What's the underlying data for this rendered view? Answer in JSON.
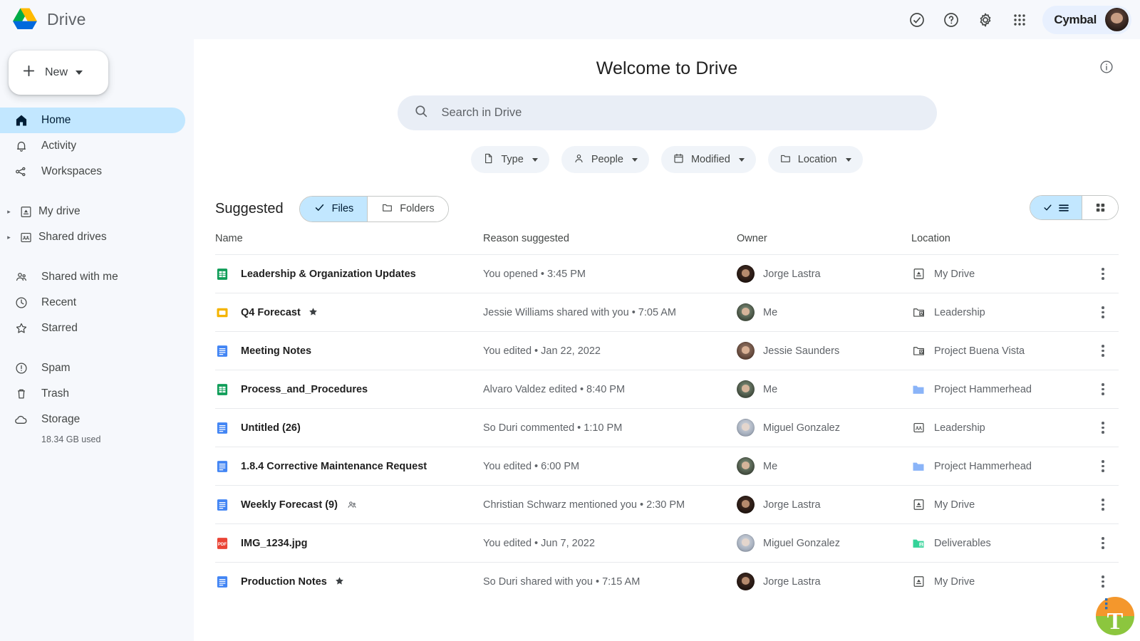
{
  "app": {
    "brand_name": "Drive",
    "logo_icon": "drive-logo-icon"
  },
  "topbar": {
    "icons": [
      {
        "name": "tasks-check-circle-icon",
        "glyph": "check-circle"
      },
      {
        "name": "help-icon",
        "glyph": "question-circle"
      },
      {
        "name": "settings-gear-icon",
        "glyph": "gear"
      },
      {
        "name": "apps-grid-icon",
        "glyph": "grid"
      }
    ],
    "account_name": "Cymbal",
    "avatar_name": "account-avatar"
  },
  "sidebar": {
    "new_button": {
      "label": "New",
      "plus_icon": "plus-icon",
      "caret_icon": "chevron-down-icon"
    },
    "items": [
      {
        "label": "Home",
        "icon": "home-icon",
        "active": true,
        "expandable": false
      },
      {
        "label": "Activity",
        "icon": "bell-icon",
        "active": false,
        "expandable": false
      },
      {
        "label": "Workspaces",
        "icon": "workspaces-icon",
        "active": false,
        "expandable": false
      },
      {
        "label": "My drive",
        "icon": "my-drive-icon",
        "active": false,
        "expandable": true
      },
      {
        "label": "Shared drives",
        "icon": "shared-drives-icon",
        "active": false,
        "expandable": true
      },
      {
        "label": "Shared with me",
        "icon": "people-icon",
        "active": false,
        "expandable": false
      },
      {
        "label": "Recent",
        "icon": "clock-icon",
        "active": false,
        "expandable": false
      },
      {
        "label": "Starred",
        "icon": "star-outline-icon",
        "active": false,
        "expandable": false
      },
      {
        "label": "Spam",
        "icon": "spam-icon",
        "active": false,
        "expandable": false
      },
      {
        "label": "Trash",
        "icon": "trash-icon",
        "active": false,
        "expandable": false
      },
      {
        "label": "Storage",
        "icon": "cloud-icon",
        "active": false,
        "expandable": false
      }
    ],
    "storage_used": "18.34 GB used"
  },
  "main": {
    "welcome_title": "Welcome to Drive",
    "info_icon": "info-icon",
    "search": {
      "placeholder": "Search in Drive",
      "value": "",
      "icon": "search-icon"
    },
    "filter_chips": [
      {
        "label": "Type",
        "icon": "file-icon"
      },
      {
        "label": "People",
        "icon": "person-icon"
      },
      {
        "label": "Modified",
        "icon": "calendar-icon"
      },
      {
        "label": "Location",
        "icon": "folder-icon"
      }
    ],
    "suggested_label": "Suggested",
    "segmented": [
      {
        "label": "Files",
        "icon": "check-icon",
        "selected": true
      },
      {
        "label": "Folders",
        "icon": "folder-icon",
        "selected": false
      }
    ],
    "view_toggle": [
      {
        "name": "list-view",
        "icon": "list-icon",
        "selected": true
      },
      {
        "name": "grid-view",
        "icon": "grid-icon",
        "selected": false
      }
    ],
    "table": {
      "columns": [
        "Name",
        "Reason suggested",
        "Owner",
        "Location"
      ],
      "rows": [
        {
          "name": "Leadership & Organization Updates",
          "file_icon": "sheets-icon",
          "starred": false,
          "shared": false,
          "reason": "You opened • 3:45 PM",
          "owner": "Jorge Lastra",
          "owner_avatar": "av-jorge",
          "location": "My Drive",
          "location_icon": "my-drive-icon"
        },
        {
          "name": "Q4 Forecast",
          "file_icon": "slides-icon",
          "starred": true,
          "shared": false,
          "reason": "Jessie Williams shared with you • 7:05 AM",
          "owner": "Me",
          "owner_avatar": "av-me",
          "location": "Leadership",
          "location_icon": "shared-folder-icon"
        },
        {
          "name": "Meeting Notes",
          "file_icon": "docs-icon",
          "starred": false,
          "shared": false,
          "reason": "You edited • Jan 22, 2022",
          "owner": "Jessie Saunders",
          "owner_avatar": "av-jessie",
          "location": "Project Buena Vista",
          "location_icon": "shared-folder-icon"
        },
        {
          "name": "Process_and_Procedures",
          "file_icon": "sheets-icon",
          "starred": false,
          "shared": false,
          "reason": "Alvaro Valdez edited • 8:40 PM",
          "owner": "Me",
          "owner_avatar": "av-me",
          "location": "Project Hammerhead",
          "location_icon": "blue-folder-icon"
        },
        {
          "name": "Untitled (26)",
          "file_icon": "docs-icon",
          "starred": false,
          "shared": false,
          "reason": "So Duri commented • 1:10 PM",
          "owner": "Miguel Gonzalez",
          "owner_avatar": "av-miguel",
          "location": "Leadership",
          "location_icon": "shared-drive-icon"
        },
        {
          "name": "1.8.4 Corrective Maintenance Request",
          "file_icon": "docs-icon",
          "starred": false,
          "shared": false,
          "reason": "You edited • 6:00 PM",
          "owner": "Me",
          "owner_avatar": "av-me",
          "location": "Project Hammerhead",
          "location_icon": "blue-folder-icon"
        },
        {
          "name": "Weekly Forecast (9)",
          "file_icon": "docs-icon",
          "starred": false,
          "shared": true,
          "reason": "Christian Schwarz mentioned you • 2:30 PM",
          "owner": "Jorge Lastra",
          "owner_avatar": "av-jorge",
          "location": "My Drive",
          "location_icon": "my-drive-icon"
        },
        {
          "name": "IMG_1234.jpg",
          "file_icon": "pdf-icon",
          "starred": false,
          "shared": false,
          "reason": "You edited • Jun 7, 2022",
          "owner": "Miguel Gonzalez",
          "owner_avatar": "av-miguel",
          "location": "Deliverables",
          "location_icon": "green-folder-icon"
        },
        {
          "name": "Production Notes",
          "file_icon": "docs-icon",
          "starred": true,
          "shared": false,
          "reason": "So Duri shared with you • 7:15 AM",
          "owner": "Jorge Lastra",
          "owner_avatar": "av-jorge",
          "location": "My Drive",
          "location_icon": "my-drive-icon"
        }
      ],
      "row_menu_icon": "more-vert-icon"
    }
  },
  "colors": {
    "accent_blue": "#c2e7ff",
    "sidebar_bg": "#f6f8fc",
    "search_bg": "#e9eef6",
    "sheets_green": "#0f9d58",
    "slides_yellow": "#f4b400",
    "docs_blue": "#4285f4",
    "pdf_red": "#ea4335",
    "folder_blue": "#8ab4f8",
    "folder_green": "#34d399"
  },
  "watermark": {
    "name": "site-watermark"
  }
}
